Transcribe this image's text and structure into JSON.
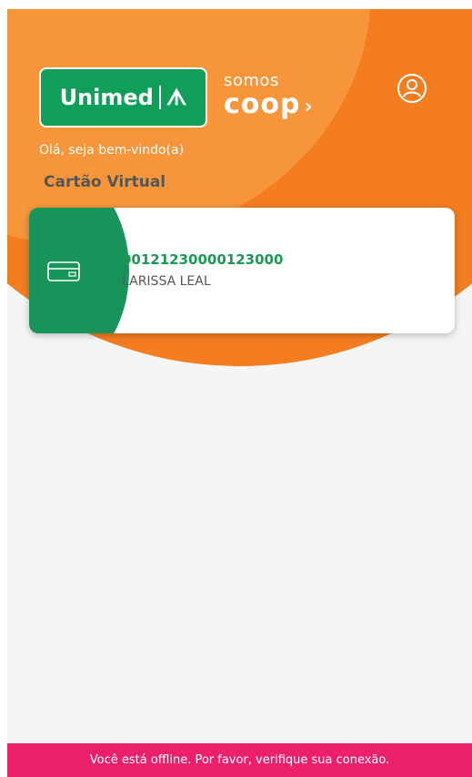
{
  "header": {
    "brand": "Unimed",
    "coop_top": "somos",
    "coop_bottom": "coop",
    "greeting": "Olá, seja bem-vindo(a)",
    "section_title": "Cartão Virtual"
  },
  "card": {
    "number": "00121230000123000",
    "holder": "LARISSA LEAL"
  },
  "status": {
    "offline_message": "Você está offline. Por favor, verifique sua conexão."
  },
  "colors": {
    "orange": "#f47d20",
    "green": "#18935a",
    "alert": "#ec1f69"
  },
  "icons": [
    "profile-icon",
    "card-icon"
  ]
}
